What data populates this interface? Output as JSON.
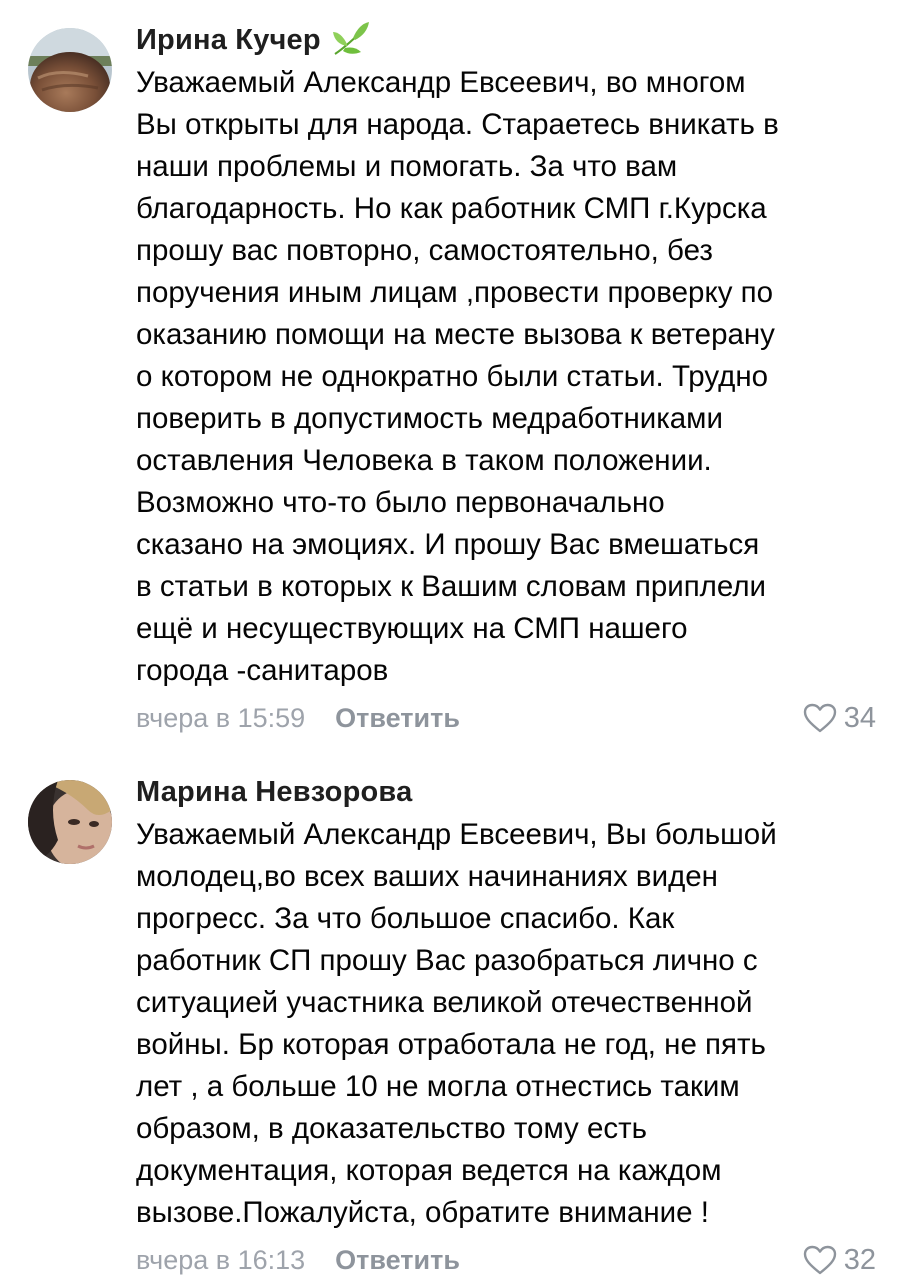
{
  "comments": [
    {
      "author": "Ирина Кучер",
      "badge_icon": "leaf-badge-icon",
      "text": "Уважаемый Александр Евсеевич, во многом\nВы открыты для народа. Стараетесь вникать в\nнаши проблемы и помогать. За что вам\nблагодарность. Но как работник СМП г.Курска\nпрошу вас повторно, самостоятельно, без\nпоручения иным лицам ,провести проверку по\nоказанию помощи на месте вызова к ветерану\nо котором не однократно были статьи. Трудно\nповерить в допустимость медработниками\nоставления Человека в таком положении.\nВозможно  что-то было первоначально\nсказано на эмоциях. И прошу Вас вмешаться\nв статьи в которых к Вашим словам приплели\nещё и несуществующих на СМП нашего\nгорода -санитаров",
      "time": "вчера в 15:59",
      "reply_label": "Ответить",
      "likes": "34"
    },
    {
      "author": "Марина Невзорова",
      "text": "Уважаемый Александр Евсеевич, Вы большой\nмолодец,во всех ваших начинаниях виден\nпрогресс. За что большое спасибо. Как\nработник СП прошу Вас разобраться лично с\nситуацией участника великой отечественной\nвойны. Бр которая отработала не год, не пять\nлет , а больше 10 не могла отнестись таким\nобразом, в доказательство тому есть\nдокументация, которая ведется на каждом\nвызове.Пожалуйста, обратите внимание !",
      "time": "вчера в 16:13",
      "reply_label": "Ответить",
      "likes": "32"
    }
  ],
  "colors": {
    "meta_gray": "#9ea3ab",
    "reply_gray": "#8e949c",
    "leaf_green": "#6fbf3c"
  }
}
